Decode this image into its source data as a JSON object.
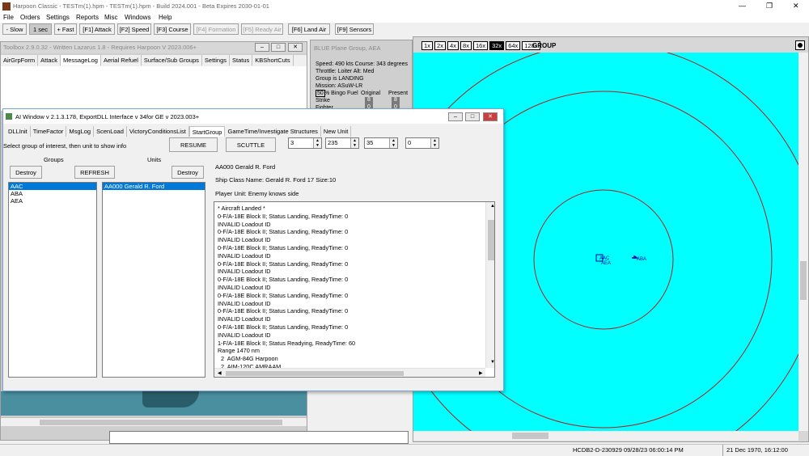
{
  "app": {
    "title": "Harpoon Classic - TESTm(1).hpm - TESTm(1).hpm - Build 2024.001 - Beta Expires 2030-01-01",
    "minimize": "—",
    "maximize": "❐",
    "close": "✕"
  },
  "menu": [
    "File",
    "Orders",
    "Settings",
    "Reports",
    "Misc",
    "Windows",
    "Help"
  ],
  "toolbar": [
    "- Slow",
    "1 sec",
    "+ Fast",
    "[F1] Attack",
    "[F2] Speed",
    "[F3] Course",
    "[F4] Formation",
    "[F5] Ready Air",
    "[F6] Land Air",
    "[F9] Sensors"
  ],
  "toolbox": {
    "title": "Toolbox 2.9.0.32 - Written Lazarus 1.8 - Requires Harpoon V 2023.006+",
    "tabs": [
      "AirGrpForm",
      "Attack",
      "MessageLog",
      "Aerial Refuel",
      "Surface/Sub Groups",
      "Settings",
      "Status",
      "KBShortCuts"
    ]
  },
  "blue_panel": {
    "title": "BLUE Plane Group, AEA",
    "lines": [
      "Speed: 490 kts  Course: 343 degrees",
      "Throttle: Loiter   Alt: Med",
      "Group is LANDING",
      "Mission: ASuW-LR"
    ],
    "fuel_pct": "50",
    "fuel_label": "% Bingo Fuel",
    "col_original": "Original",
    "col_present": "Present",
    "rows": [
      {
        "label": "Strike",
        "original": "8",
        "present": "8"
      },
      {
        "label": "Fighter",
        "original": "0",
        "present": "0"
      }
    ]
  },
  "map": {
    "zoom": [
      "1x",
      "2x",
      "4x",
      "8x",
      "16x",
      "32x",
      "64x",
      "128x"
    ],
    "selected_zoom": "32x",
    "label": "GROUP",
    "units": [
      "AAC",
      "AEA",
      "ABA"
    ]
  },
  "ai": {
    "title": "AI Window v 2.1.3.178, ExportDLL Interface v 34for GE v 2023.003+",
    "tabs": [
      "DLLInit",
      "TimeFactor",
      "MsgLog",
      "ScenLoad",
      "VictoryConditionsList",
      "StartGroup",
      "GameTime/Investigate Structures",
      "New Unit"
    ],
    "active_tab": "StartGroup",
    "instruction": "Select group of interest, then unit to show info",
    "resume": "RESUME",
    "scuttle": "SCUTTLE",
    "spins": [
      "3",
      "235",
      "35",
      "0"
    ],
    "groups_label": "Groups",
    "units_label": "Units",
    "destroy": "Destroy",
    "refresh": "REFRESH",
    "groups": [
      "AAC",
      "ABA",
      "AEA"
    ],
    "units": [
      "AA000 Gerald R. Ford"
    ],
    "unit_name": "AA000 Gerald R. Ford",
    "ship_class": "Ship Class Name: Gerald R. Ford 17 Size:10",
    "player_unit": "Player Unit: Enemy knows side",
    "log": [
      "* Aircraft Landed *",
      "0-F/A-18E Block II; Status Landing, ReadyTime: 0",
      "INVALID Loadout ID",
      "0-F/A-18E Block II; Status Landing, ReadyTime: 0",
      "INVALID Loadout ID",
      "0-F/A-18E Block II; Status Landing, ReadyTime: 0",
      "INVALID Loadout ID",
      "0-F/A-18E Block II; Status Landing, ReadyTime: 0",
      "INVALID Loadout ID",
      "0-F/A-18E Block II; Status Landing, ReadyTime: 0",
      "INVALID Loadout ID",
      "0-F/A-18E Block II; Status Landing, ReadyTime: 0",
      "INVALID Loadout ID",
      "0-F/A-18E Block II; Status Landing, ReadyTime: 0",
      "INVALID Loadout ID",
      "0-F/A-18E Block II; Status Landing, ReadyTime: 0",
      "INVALID Loadout ID",
      "1-F/A-18E Block II; Status Readying, ReadyTime: 60",
      "Range 1470 nm",
      "  2  AGM-84G Harpoon",
      "  2  AIM-120C AMRAAM"
    ]
  },
  "status": {
    "build": "HCDB2-D-230929 09/28/23 06:00:14 PM",
    "time": "21 Dec 1970, 16:12:00"
  },
  "colors": {
    "sea": "#00ffff",
    "ring": "#b02020",
    "select": "#0078d7"
  }
}
